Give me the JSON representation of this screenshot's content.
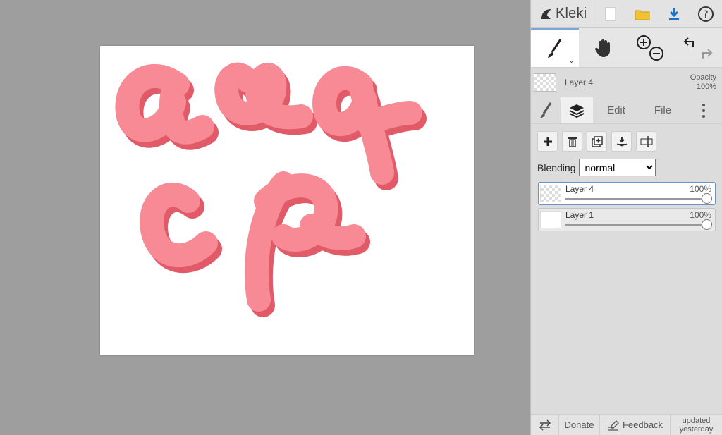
{
  "app": {
    "name": "Kleki"
  },
  "toolbar": {
    "icons": [
      "new-file-icon",
      "open-folder-icon",
      "download-icon",
      "help-icon"
    ],
    "tools": [
      "brush-icon",
      "hand-icon",
      "zoom-icon",
      "undo-redo-icon"
    ]
  },
  "current_layer": {
    "name": "Layer 4",
    "opacity_label": "Opacity",
    "opacity_value": "100%"
  },
  "tabs": {
    "edit": "Edit",
    "file": "File"
  },
  "blending": {
    "label": "Blending",
    "value": "normal"
  },
  "layers": [
    {
      "name": "Layer 4",
      "opacity": "100%",
      "selected": true
    },
    {
      "name": "Layer 1",
      "opacity": "100%",
      "selected": false
    }
  ],
  "footer": {
    "donate": "Donate",
    "feedback": "Feedback",
    "updated": "updated yesterday"
  },
  "colors": {
    "ink": "#f78a95",
    "shadow": "#e05a68",
    "workspace": "#9e9e9e",
    "panel": "#dcdcdc",
    "accent": "#1a73c8"
  }
}
